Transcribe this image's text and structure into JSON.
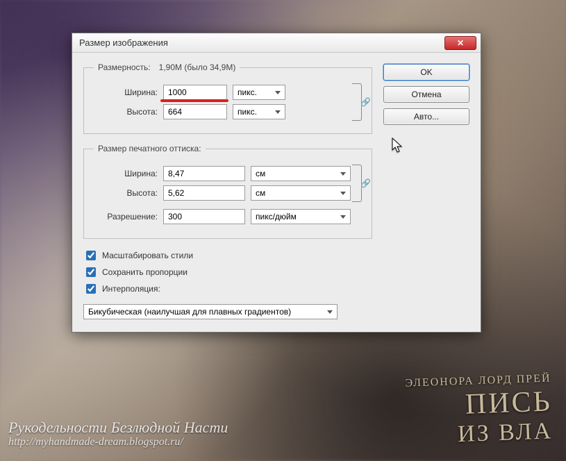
{
  "window": {
    "title": "Размер изображения",
    "close_glyph": "✕"
  },
  "pixel_dimensions": {
    "legend_label": "Размерность:",
    "legend_value": "1,90M (было 34,9M)",
    "width_label": "Ширина:",
    "width_value": "1000",
    "width_unit": "пикс.",
    "height_label": "Высота:",
    "height_value": "664",
    "height_unit": "пикс.",
    "link_glyph": "🔗"
  },
  "print_dimensions": {
    "legend": "Размер печатного оттиска:",
    "width_label": "Ширина:",
    "width_value": "8,47",
    "width_unit": "см",
    "height_label": "Высота:",
    "height_value": "5,62",
    "height_unit": "см",
    "resolution_label": "Разрешение:",
    "resolution_value": "300",
    "resolution_unit": "пикс/дюйм",
    "link_glyph": "🔗"
  },
  "options": {
    "scale_styles": "Масштабировать стили",
    "constrain": "Сохранить пропорции",
    "interpolation": "Интерполяция:",
    "method": "Бикубическая (наилучшая для плавных градиентов)"
  },
  "buttons": {
    "ok": "OK",
    "cancel": "Отмена",
    "auto": "Авто..."
  },
  "background": {
    "watermark_line1": "Рукодельности Безлюдной Насти",
    "watermark_url": "http://myhandmade-dream.blogspot.ru/",
    "book_author": "ЭЛЕОНОРА ЛОРД ПРЕЙ",
    "book_line1": "ПИСЬ",
    "book_line2": "ИЗ ВЛА"
  }
}
